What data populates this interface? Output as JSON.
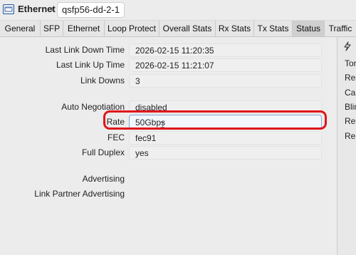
{
  "header": {
    "title": "Ethernet",
    "separator": "›",
    "interface": "qsfp56-dd-2-1"
  },
  "tabs": [
    {
      "label": "General"
    },
    {
      "label": "SFP"
    },
    {
      "label": "Ethernet"
    },
    {
      "label": "Loop Protect"
    },
    {
      "label": "Overall Stats"
    },
    {
      "label": "Rx Stats"
    },
    {
      "label": "Tx Stats"
    },
    {
      "label": "Status",
      "active": true
    },
    {
      "label": "Traffic"
    }
  ],
  "status": {
    "last_link_down_time": {
      "label": "Last Link Down Time",
      "value": "2026-02-15 11:20:35"
    },
    "last_link_up_time": {
      "label": "Last Link Up Time",
      "value": "2026-02-15 11:21:07"
    },
    "link_downs": {
      "label": "Link Downs",
      "value": "3"
    },
    "auto_negotiation": {
      "label": "Auto Negotiation",
      "value": "disabled"
    },
    "rate": {
      "label": "Rate",
      "value": "50Gbps"
    },
    "fec": {
      "label": "FEC",
      "value": "fec91"
    },
    "full_duplex": {
      "label": "Full Duplex",
      "value": "yes"
    },
    "advertising": {
      "label": "Advertising"
    },
    "link_partner_advertising": {
      "label": "Link Partner Advertising"
    }
  },
  "side_panel": {
    "icon": "lightning-icon",
    "items": [
      "Torc",
      "Res",
      "Cab",
      "Blin",
      "Res",
      "Res"
    ]
  },
  "colors": {
    "highlight": "#e0141b",
    "field_focus_border": "#7fa8e0"
  }
}
